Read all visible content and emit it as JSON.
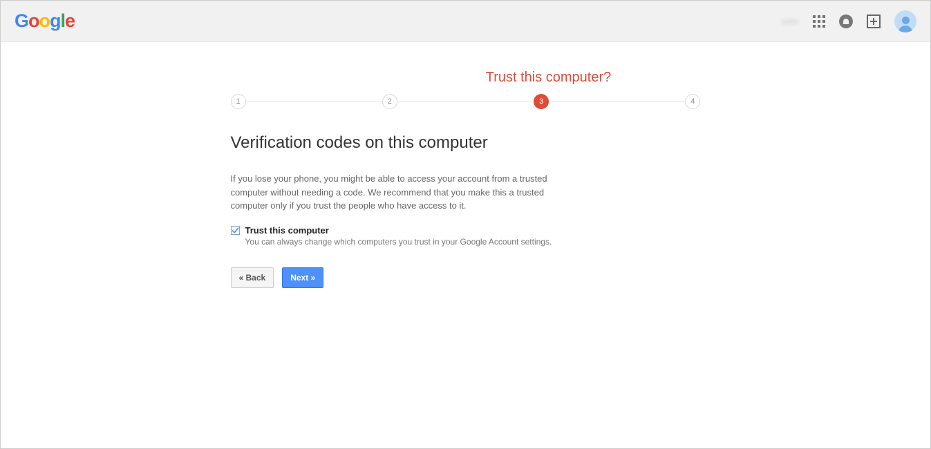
{
  "header": {
    "logo_text": "Google",
    "blurred_label": "user"
  },
  "stepper": {
    "title": "Trust this computer?",
    "steps": [
      "1",
      "2",
      "3",
      "4"
    ],
    "active_index": 2
  },
  "main": {
    "heading": "Verification codes on this computer",
    "description": "If you lose your phone, you might be able to access your account from a trusted computer without needing a code. We recommend that you make this a trusted computer only if you trust the people who have access to it.",
    "checkbox": {
      "checked": true,
      "label": "Trust this computer",
      "sublabel": "You can always change which computers you trust in your Google Account settings."
    }
  },
  "buttons": {
    "back": "« Back",
    "next": "Next »"
  }
}
